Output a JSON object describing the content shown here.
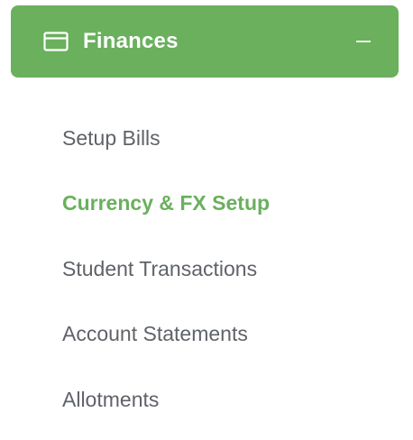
{
  "section": {
    "title": "Finances",
    "icon": "credit-card-icon",
    "toggle_icon": "minus-icon",
    "color": "#6ab05d"
  },
  "submenu": {
    "items": [
      {
        "label": "Setup Bills",
        "active": false
      },
      {
        "label": "Currency & FX Setup",
        "active": true
      },
      {
        "label": "Student Transactions",
        "active": false
      },
      {
        "label": "Account Statements",
        "active": false
      },
      {
        "label": "Allotments",
        "active": false
      }
    ],
    "text_color": "#5f6368",
    "active_color": "#6ab05d"
  }
}
